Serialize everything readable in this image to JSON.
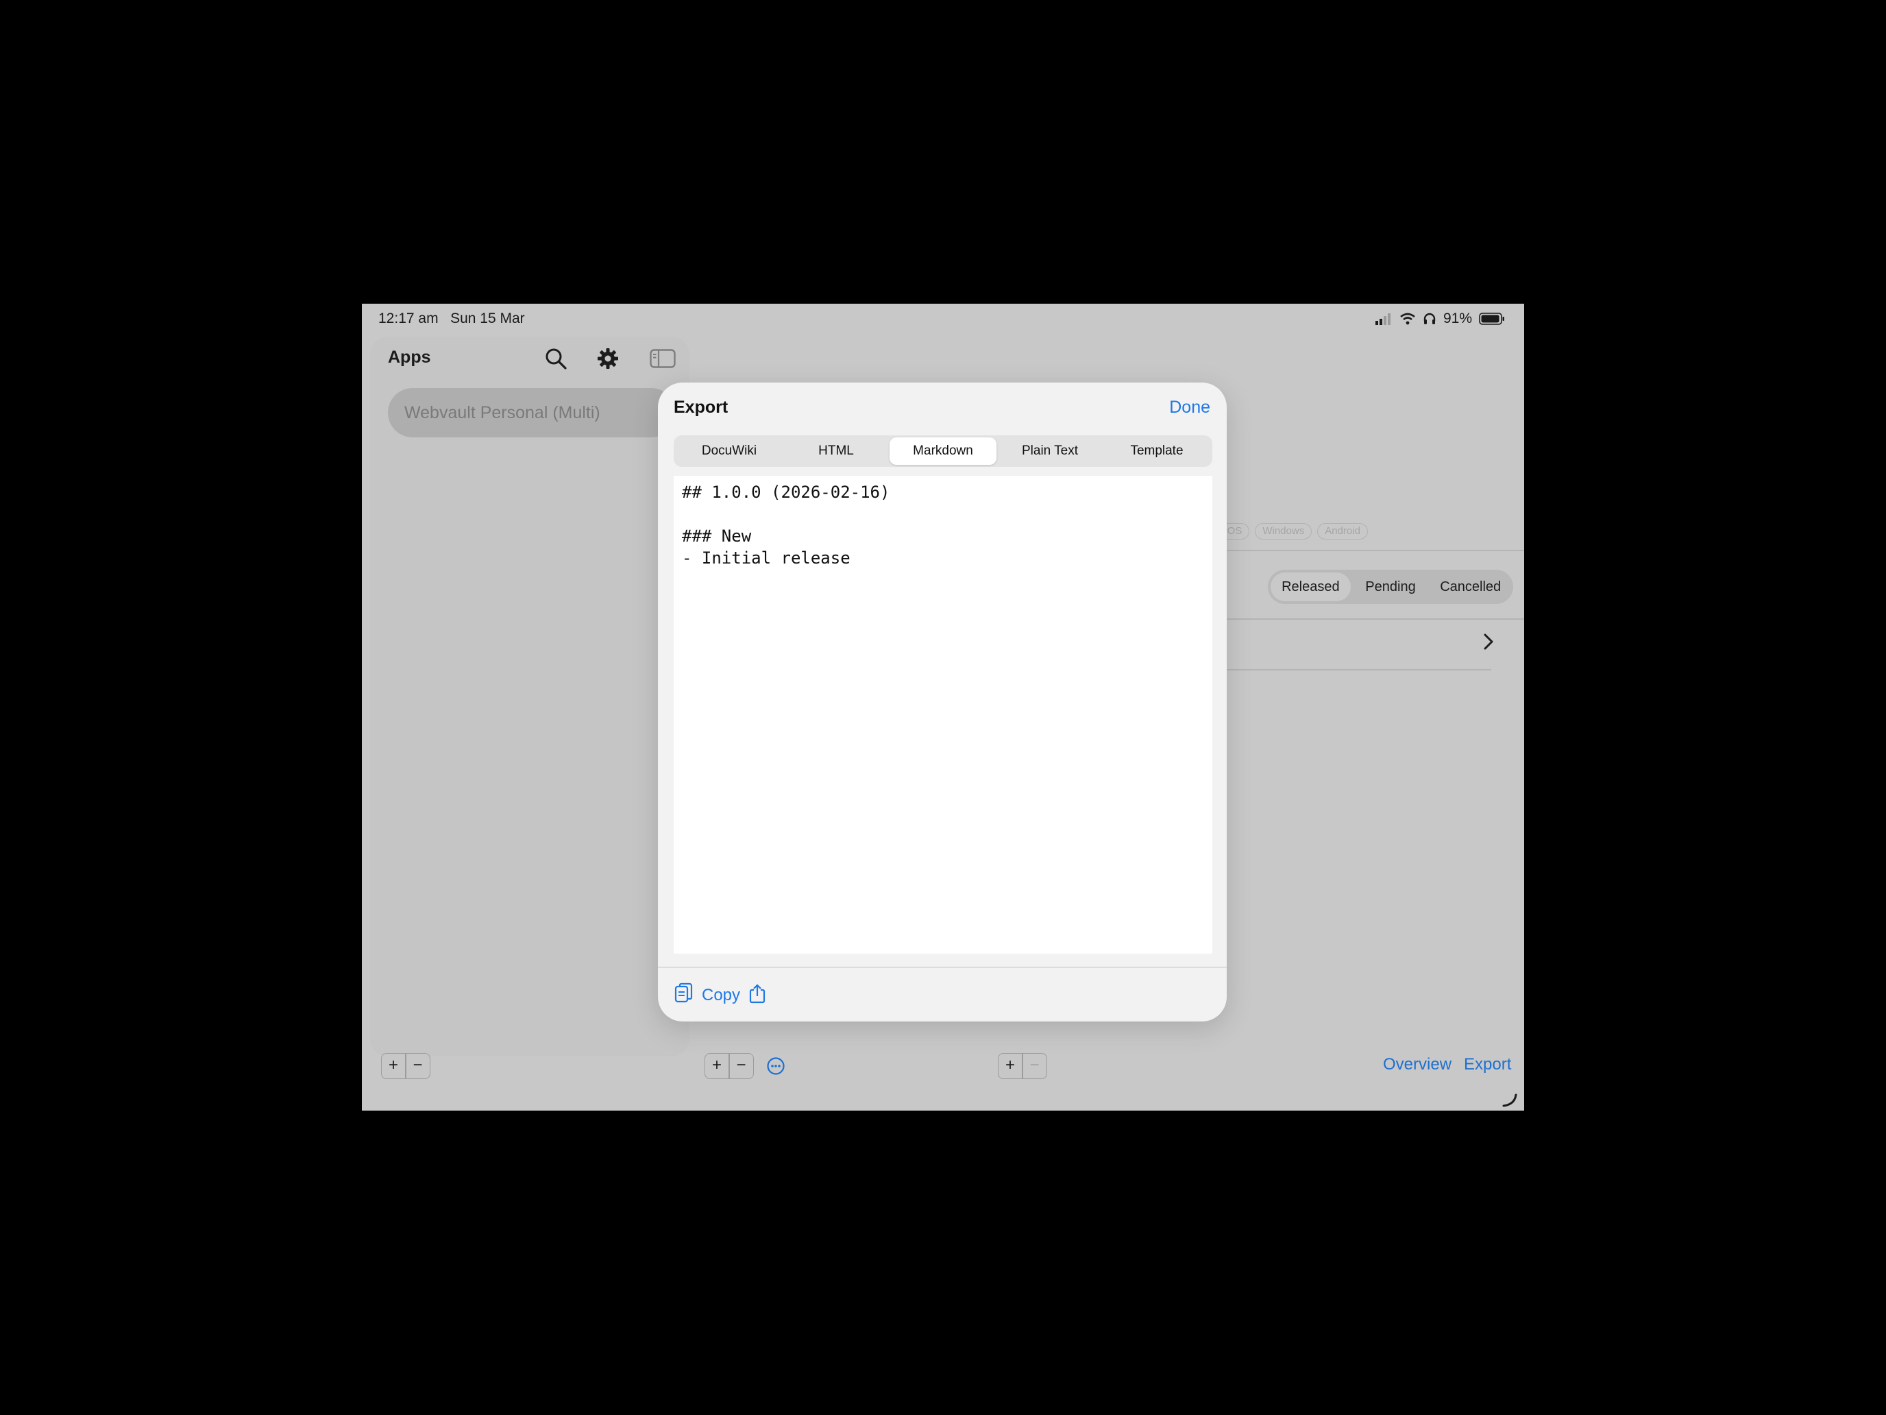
{
  "status_bar": {
    "time": "12:17 am",
    "date": "Sun 15 Mar",
    "battery": "91%"
  },
  "sidebar": {
    "title": "Apps",
    "apps": [
      {
        "label": "Webvault Personal (Multi)"
      }
    ]
  },
  "detail": {
    "platforms": [
      "tvOS",
      "Windows",
      "Android"
    ],
    "status_filter": {
      "options": [
        "Released",
        "Pending",
        "Cancelled"
      ],
      "selected": "Released"
    },
    "bottom_links": {
      "overview": "Overview",
      "export": "Export"
    }
  },
  "export_modal": {
    "title": "Export",
    "done_label": "Done",
    "tabs": [
      "DocuWiki",
      "HTML",
      "Markdown",
      "Plain Text",
      "Template"
    ],
    "selected_tab": "Markdown",
    "content": "## 1.0.0 (2026-02-16)\n\n### New\n- Initial release",
    "copy_label": "Copy"
  },
  "colors": {
    "accent": "#1e78e6",
    "dimmed_background": "#c8c8c8"
  }
}
